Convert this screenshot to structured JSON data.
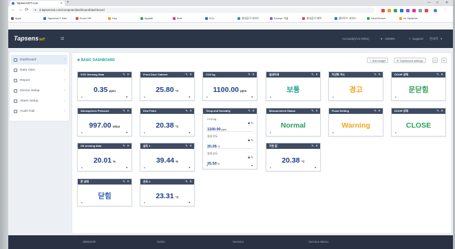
{
  "browser": {
    "tab_title": "TapsensIOT.com",
    "url": "d.tapsensiot.com/computer/dashboard/dashboard",
    "bookmarks": [
      "Apps",
      "TapsensIoT Sale",
      "Krzen NR",
      "Hey",
      "Apptab",
      "Kids",
      "ECo",
      "실내공기 서비스",
      "Ecoeye 기술",
      "실내공기 에어",
      "클라우드 서비스",
      "NanoSensor",
      "Ax Tapsinde"
    ]
  },
  "header": {
    "logo": "Tapsens",
    "logo_suffix": "IoT",
    "account": "Account(CV1-0001)",
    "user": "ADMIN",
    "support": "Support",
    "language": "한국어"
  },
  "sidebar": {
    "items": [
      {
        "label": "Dashboard"
      },
      {
        "label": "Data View"
      },
      {
        "label": "Report"
      },
      {
        "label": "Device Setup"
      },
      {
        "label": "Alarm Setup"
      },
      {
        "label": "Audit Trail"
      }
    ]
  },
  "main": {
    "title": "BASIC DASHBOARD",
    "add_widget": "Add widget",
    "settings": "Dashboard settings"
  },
  "widgets": [
    {
      "title": "VOC Sensing Data",
      "value": "0.35",
      "unit": "ppm",
      "color": "#1e3f8c"
    },
    {
      "title": "Front Door Cabinet",
      "value": "25.80",
      "unit": "°C",
      "color": "#1e3f8c"
    },
    {
      "title": "CO2 kg",
      "value": "1100.00",
      "unit": "ppm",
      "color": "#1e3f8c"
    },
    {
      "title": "실내미세",
      "value": "보통",
      "color": "#23a394"
    },
    {
      "title": "이산화 가스",
      "value": "경고",
      "color": "#f0a21c"
    },
    {
      "title": "DOOR 상태",
      "value": "문닫힘",
      "color": "#2f9e55"
    },
    {
      "title": "Atmospheric Pressure",
      "value": "997.00",
      "unit": "mbar",
      "color": "#1e3f8c"
    },
    {
      "title": "Dew Point",
      "value": "20.38",
      "unit": "°C",
      "color": "#1e3f8c"
    },
    {
      "title": "Temp and Humidity",
      "rows": [
        {
          "label": "CO2 kg",
          "value": "1100.00",
          "unit": "ppm"
        },
        {
          "label": "실내 온도",
          "value": "20.05",
          "unit": "°C"
        },
        {
          "label": "실내 습도",
          "value": "25.50",
          "unit": "%"
        }
      ]
    },
    {
      "title": "Measurement Status",
      "value": "Normal",
      "color": "#2aa05a"
    },
    {
      "title": "Flood Setting",
      "value": "Warning",
      "color": "#f2a71b"
    },
    {
      "title": "DOOR 상태",
      "value": "CLOSE",
      "color": "#28a05a"
    },
    {
      "title": "Oil sensing data",
      "value": "20.01",
      "unit": "%",
      "color": "#1e3f8c"
    },
    {
      "title": "습도 1",
      "value": "39.44",
      "unit": "%",
      "color": "#1e3f8c"
    },
    {
      "title": "기온 값",
      "value": "20.38",
      "unit": "°C",
      "color": "#1e3f8c"
    },
    {
      "title": "문 상태",
      "value": "닫힘",
      "color": "#2b5fb8"
    },
    {
      "title": "온도 2",
      "value": "23.31",
      "unit": "°C",
      "color": "#1e3f8c"
    }
  ],
  "footer": {
    "links": [
      "SENSOR",
      "Sales",
      "Service",
      "Service Menu"
    ]
  }
}
